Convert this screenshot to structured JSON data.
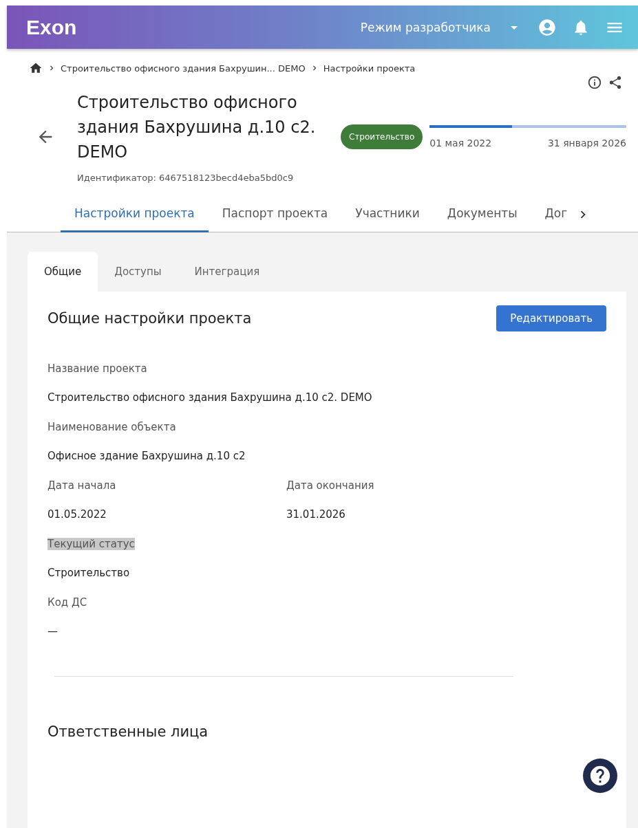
{
  "header": {
    "logo": "Exon",
    "mode": "Режим разработчика"
  },
  "breadcrumbs": [
    "Строительство офисного здания Бахрушин... DEMO",
    "Настройки проекта"
  ],
  "project": {
    "title": "Строительство офисного здания Бахрушина д.10 с2. DEMO",
    "identifier": "Идентификатор: 6467518123becd4eba5bd0c9",
    "status": "Строительство",
    "start": "01 мая 2022",
    "end": "31 января 2026",
    "level": 0.42
  },
  "tabs": [
    {
      "label": "Настройки проекта",
      "selected": true
    },
    {
      "label": "Паспорт проекта",
      "selected": false
    },
    {
      "label": "Участники",
      "selected": false
    },
    {
      "label": "Документы",
      "selected": false
    },
    {
      "label": "Дог",
      "selected": false
    }
  ],
  "subtabs": [
    {
      "label": "Общие",
      "selected": true
    },
    {
      "label": "Доступы",
      "selected": false
    },
    {
      "label": "Интеграция",
      "selected": false
    }
  ],
  "section": {
    "title": "Общие настройки проекта",
    "button": "Редактировать"
  },
  "field_rows": [
    [
      {
        "label": "Название проекта",
        "value": "Строительство офисного здания Бахрушина д.10 с2. DEMO",
        "highlighted": false
      }
    ],
    [
      {
        "label": "Наименование объекта",
        "value": "Офисное здание Бахрушина д.10 с2",
        "highlighted": false
      }
    ],
    [
      {
        "label": "Дата начала",
        "value": "01.05.2022",
        "highlighted": false
      },
      {
        "label": "Дата окончания",
        "value": "31.01.2026",
        "highlighted": false
      }
    ],
    [
      {
        "label": "Текущий статус",
        "value": "Строительство",
        "highlighted": true
      }
    ],
    [
      {
        "label": "Код ДС",
        "value": "—",
        "highlighted": false
      }
    ]
  ],
  "section2": {
    "title": "Ответственные лица"
  }
}
